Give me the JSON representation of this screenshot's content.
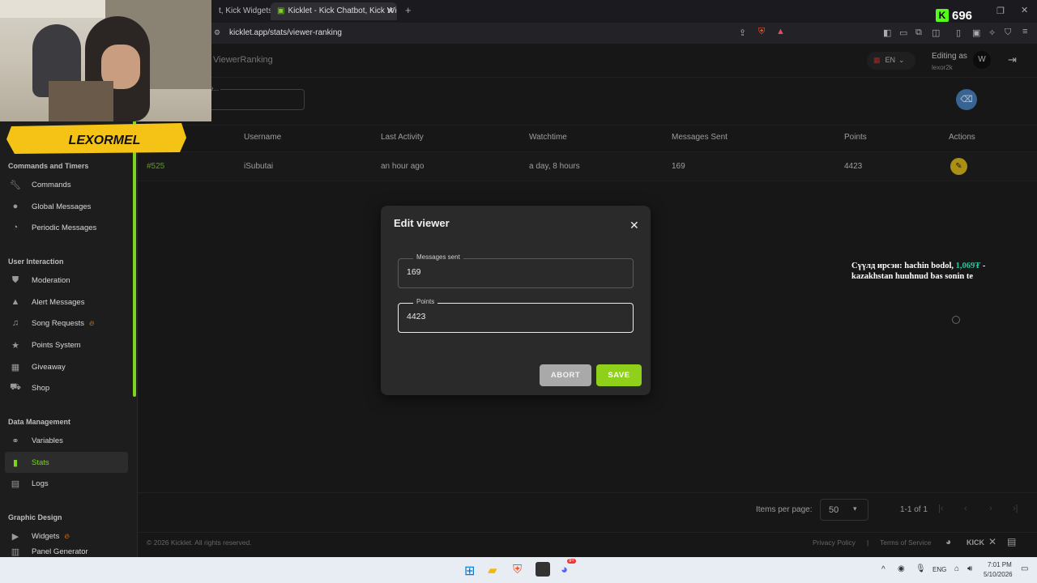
{
  "browser": {
    "tabs": [
      {
        "label": "t, Kick Widgets -"
      },
      {
        "label": "Kicklet - Kick Chatbot, Kick Widg"
      }
    ],
    "url": "kicklet.app/stats/viewer-ranking"
  },
  "stream_overlay": {
    "streamer_name": "LEXORMEL",
    "kick_count": "696",
    "chat_text_pre": "Сүүлд ирсэн: hachin bodol, ",
    "chat_text_amount": "1,069₮",
    "chat_text_post": " - kazakhstan huuhnud bas sonin te"
  },
  "header": {
    "page_title": "ViewerRanking",
    "language": "EN",
    "editing_as_label": "Editing as",
    "username": "lexor2k",
    "search_placeholder": "e..."
  },
  "sidebar": {
    "sections": [
      {
        "title": "Commands and Timers"
      },
      {
        "title": "User Interaction"
      },
      {
        "title": "Data Management"
      },
      {
        "title": "Graphic Design"
      }
    ],
    "items": [
      {
        "label": "Commands",
        "icon": "wrench-icon"
      },
      {
        "label": "Global Messages",
        "icon": "chat-bubble-icon"
      },
      {
        "label": "Periodic Messages",
        "icon": "clock-icon"
      },
      {
        "label": "Moderation",
        "icon": "shield-icon"
      },
      {
        "label": "Alert Messages",
        "icon": "warning-icon"
      },
      {
        "label": "Song Requests",
        "icon": "music-note-icon"
      },
      {
        "label": "Points System",
        "icon": "star-icon"
      },
      {
        "label": "Giveaway",
        "icon": "gift-icon"
      },
      {
        "label": "Shop",
        "icon": "cart-icon"
      },
      {
        "label": "Variables",
        "icon": "link-icon"
      },
      {
        "label": "Stats",
        "icon": "bar-chart-icon"
      },
      {
        "label": "Logs",
        "icon": "logs-icon"
      },
      {
        "label": "Widgets",
        "icon": "video-icon"
      },
      {
        "label": "Panel Generator",
        "icon": "panel-icon"
      }
    ]
  },
  "table": {
    "columns": [
      "Username",
      "Last Activity",
      "Watchtime",
      "Messages Sent",
      "Points",
      "Actions"
    ],
    "rows": [
      {
        "rank": "#525",
        "username": "iSubutai",
        "last_activity": "an hour ago",
        "watchtime": "a day, 8 hours",
        "messages_sent": "169",
        "points": "4423"
      }
    ]
  },
  "pagination": {
    "items_per_page_label": "Items per page:",
    "items_per_page": "50",
    "range": "1-1 of 1"
  },
  "footer": {
    "copyright": "© 2026 Kicklet. All rights reserved.",
    "privacy": "Privacy Policy",
    "separator": "|",
    "terms": "Terms of Service",
    "kick_label": "KICK"
  },
  "modal": {
    "title": "Edit viewer",
    "messages_label": "Messages sent",
    "messages_value": "169",
    "points_label": "Points",
    "points_value": "4423",
    "abort_label": "ABORT",
    "save_label": "SAVE"
  },
  "taskbar": {
    "lang": "ENG",
    "time": "7:01 PM",
    "date": "5/10/2026",
    "discord_badge": "9+"
  },
  "colors": {
    "accent": "#7ed321",
    "save_button": "#8fd11a",
    "abort_button": "#a9a9a9",
    "edit_action": "#e3c11a",
    "eraser_button": "#4a86c5"
  }
}
